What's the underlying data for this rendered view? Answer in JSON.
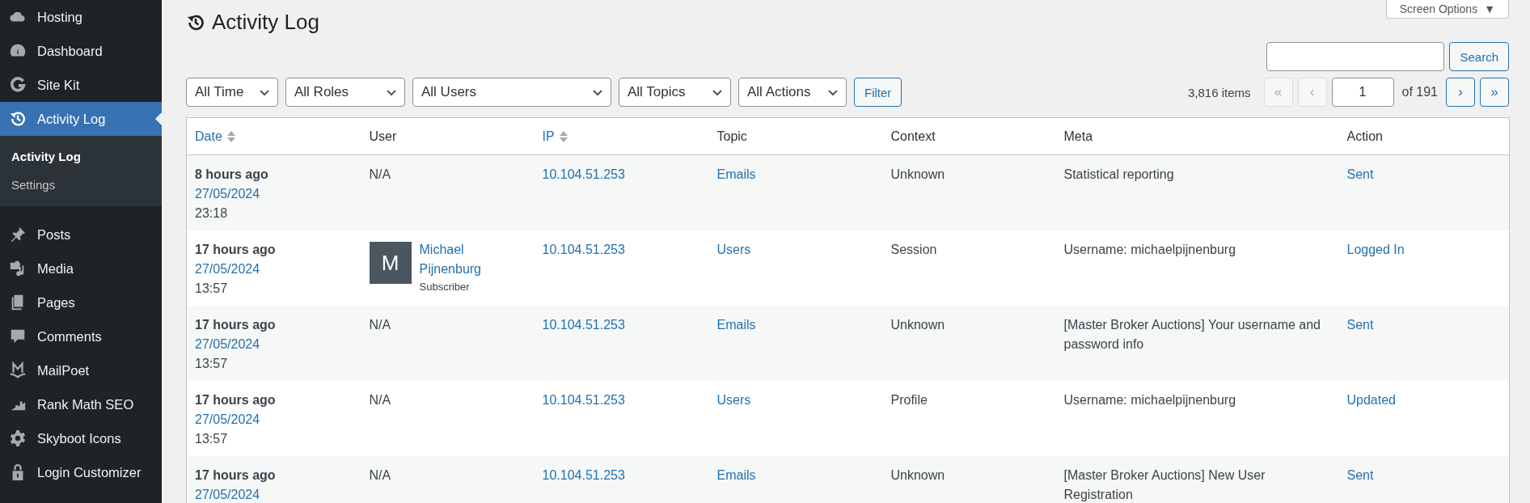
{
  "sidebar": {
    "items": [
      {
        "label": "Hosting",
        "selected": false
      },
      {
        "label": "Dashboard",
        "selected": false
      },
      {
        "label": "Site Kit",
        "selected": false
      },
      {
        "label": "Activity Log",
        "selected": true,
        "children": [
          {
            "label": "Activity Log",
            "selected": true
          },
          {
            "label": "Settings",
            "selected": false
          }
        ]
      },
      {
        "label": "Posts",
        "selected": false
      },
      {
        "label": "Media",
        "selected": false
      },
      {
        "label": "Pages",
        "selected": false
      },
      {
        "label": "Comments",
        "selected": false
      },
      {
        "label": "MailPoet",
        "selected": false
      },
      {
        "label": "Rank Math SEO",
        "selected": false
      },
      {
        "label": "Skyboot Icons",
        "selected": false
      },
      {
        "label": "Login Customizer",
        "selected": false
      }
    ]
  },
  "screen_options": {
    "label": "Screen Options",
    "caret": "▼"
  },
  "page_title": "Activity Log",
  "search": {
    "button": "Search"
  },
  "filters": [
    "All Time",
    "All Roles",
    "All Users",
    "All Topics",
    "All Actions"
  ],
  "filter_button": "Filter",
  "pagination": {
    "count": "3,816 items",
    "prev_buttons": [
      {
        "label": "«",
        "disabled": true
      },
      {
        "label": "‹",
        "disabled": true
      }
    ],
    "page": "1",
    "total": "of 191",
    "next_buttons": [
      {
        "label": "›",
        "disabled": false
      },
      {
        "label": "»",
        "disabled": false
      }
    ]
  },
  "table": {
    "columns": [
      {
        "label": "Date",
        "sortable": true
      },
      {
        "label": "User",
        "sortable": false
      },
      {
        "label": "IP",
        "sortable": true
      },
      {
        "label": "Topic",
        "sortable": false
      },
      {
        "label": "Context",
        "sortable": false
      },
      {
        "label": "Meta",
        "sortable": false
      },
      {
        "label": "Action",
        "sortable": false
      }
    ],
    "rows": [
      {
        "ago": "8 hours ago",
        "date": "27/05/2024",
        "time": "23:18",
        "user": {
          "kind": "none",
          "text": "N/A"
        },
        "ip": "10.104.51.253",
        "topic": "Emails",
        "context": "Unknown",
        "meta": "Statistical reporting",
        "action": "Sent"
      },
      {
        "ago": "17 hours ago",
        "date": "27/05/2024",
        "time": "13:57",
        "user": {
          "kind": "user",
          "initial": "M",
          "name": "Michael Pijnenburg",
          "role": "Subscriber"
        },
        "ip": "10.104.51.253",
        "topic": "Users",
        "context": "Session",
        "meta": "Username: michaelpijnenburg",
        "action": "Logged In"
      },
      {
        "ago": "17 hours ago",
        "date": "27/05/2024",
        "time": "13:57",
        "user": {
          "kind": "none",
          "text": "N/A"
        },
        "ip": "10.104.51.253",
        "topic": "Emails",
        "context": "Unknown",
        "meta": "[Master Broker Auctions] Your username and password info",
        "action": "Sent"
      },
      {
        "ago": "17 hours ago",
        "date": "27/05/2024",
        "time": "13:57",
        "user": {
          "kind": "none",
          "text": "N/A"
        },
        "ip": "10.104.51.253",
        "topic": "Users",
        "context": "Profile",
        "meta": "Username: michaelpijnenburg",
        "action": "Updated"
      },
      {
        "ago": "17 hours ago",
        "date": "27/05/2024",
        "user": {
          "kind": "none",
          "text": "N/A"
        },
        "ip": "10.104.51.253",
        "topic": "Emails",
        "context": "Unknown",
        "meta": "[Master Broker Auctions] New User Registration",
        "action": "Sent"
      }
    ]
  }
}
